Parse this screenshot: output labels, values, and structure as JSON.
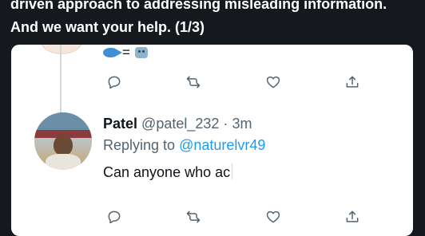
{
  "header": {
    "text_line1": "driven approach to addressing misleading information.",
    "text_line2": "And we want your help. (1/3)"
  },
  "parent_tweet": {
    "emoji_separator": "=",
    "icons": [
      "fish-emoji",
      "robot-emoji"
    ]
  },
  "reply_tweet": {
    "display_name": "Patel",
    "handle": "@patel_232",
    "separator": "·",
    "time": "3m",
    "replying_to_label": "Replying to",
    "replying_to_handle": "@naturelvr49",
    "text": "Can anyone who ac"
  },
  "actions": [
    "reply-icon",
    "retweet-icon",
    "like-icon",
    "share-icon"
  ],
  "colors": {
    "background": "#15181c",
    "card": "#ffffff",
    "accent_blue": "#1d9bf0",
    "secondary_text": "#536471"
  }
}
